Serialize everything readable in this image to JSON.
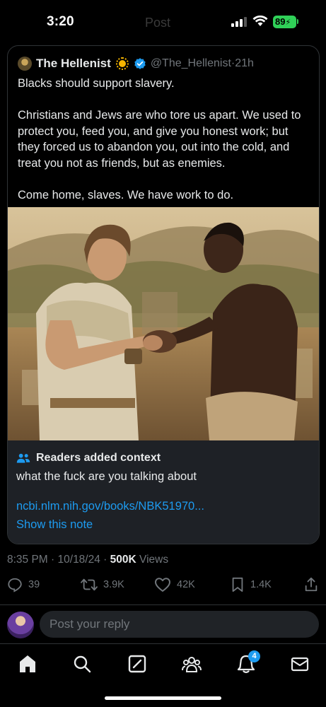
{
  "status_bar": {
    "time": "3:20",
    "battery": "89"
  },
  "screen": {
    "ghost_title": "Post"
  },
  "quoted_post": {
    "author": "The Hellenist",
    "handle": "@The_Hellenist",
    "age": "21h",
    "paragraphs": [
      "Blacks should support slavery.",
      "Christians and Jews are who tore us apart. We used to protect you, feed you, and give you honest work; but they forced us to abandon you, out into the cold, and treat you not as friends, but as enemies.",
      "Come home, slaves. We have work to do."
    ]
  },
  "context_note": {
    "title": "Readers added context",
    "body": "what the fuck are you talking about",
    "link": "ncbi.nlm.nih.gov/books/NBK51970...",
    "show_note": "Show this note"
  },
  "meta": {
    "time": "8:35 PM",
    "date": "10/18/24",
    "views_count": "500K",
    "views_label": "Views"
  },
  "actions": {
    "replies": "39",
    "reposts": "3.9K",
    "likes": "42K",
    "bookmarks": "1.4K"
  },
  "reply": {
    "placeholder": "Post your reply"
  },
  "nav": {
    "notifications_badge": "4"
  },
  "icons": [
    "avatar",
    "sun-icon",
    "verified-icon",
    "people-icon",
    "reply-icon",
    "repost-icon",
    "like-icon",
    "bookmark-icon",
    "share-icon",
    "home-icon",
    "search-icon",
    "grok-icon",
    "communities-icon",
    "notifications-icon",
    "messages-icon"
  ],
  "colors": {
    "accent": "#1d9bf0",
    "muted": "#71767b",
    "text": "#e7e9ea",
    "battery": "#30d158"
  }
}
